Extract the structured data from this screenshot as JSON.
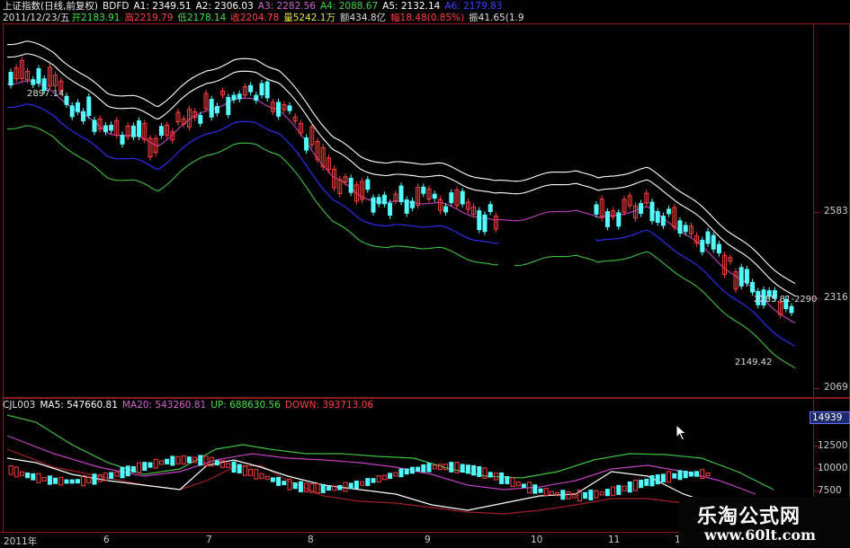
{
  "top_header": {
    "name": "上证指数(日线,前复权)",
    "indicator": "BDFD",
    "a1": "A1: 2349.51",
    "a2": "A2: 2306.03",
    "a3": "A3: 2282.56",
    "a4": "A4: 2088.67",
    "a5": "A5: 2132.14",
    "a6": "A6: 2179.83"
  },
  "info_line": {
    "date": "2011/12/23/五",
    "open": "开2183.91",
    "high": "高2219.79",
    "low": "低2178.14",
    "close": "收2204.78",
    "volume": "量5242.1万",
    "amount": "额434.8亿",
    "change": "幅18.48(0.85%)",
    "amplitude": "振41.65(1.9"
  },
  "price_axis": {
    "labels": [
      "2583",
      "2316",
      "2069"
    ]
  },
  "price_markers": {
    "peak": "2897.14",
    "mid": "2285.81-2290",
    "low": "2149.42"
  },
  "volume_header": {
    "name": "CJL003",
    "ma5": "MA5: 547660.81",
    "ma20": "MA20: 543260.81",
    "up": "UP: 688630.56",
    "down": "DOWN: 393713.06"
  },
  "volume_axis": {
    "current": "14939",
    "labels": [
      "12500",
      "10000",
      "7500"
    ]
  },
  "date_axis": {
    "labels": [
      "2011年",
      "6",
      "7",
      "8",
      "9",
      "10",
      "11",
      "1"
    ]
  },
  "watermark": {
    "title": "乐淘公式网",
    "url": "www.60lt.com"
  },
  "colors": {
    "frame": "#8b1a1a",
    "up_candle": "#ff4040",
    "down_candle": "#54ffff",
    "band_outer": "#ffffff",
    "band_mid": "#c040c0",
    "band_inner": "#3030ff",
    "band_low": "#40c040"
  }
}
